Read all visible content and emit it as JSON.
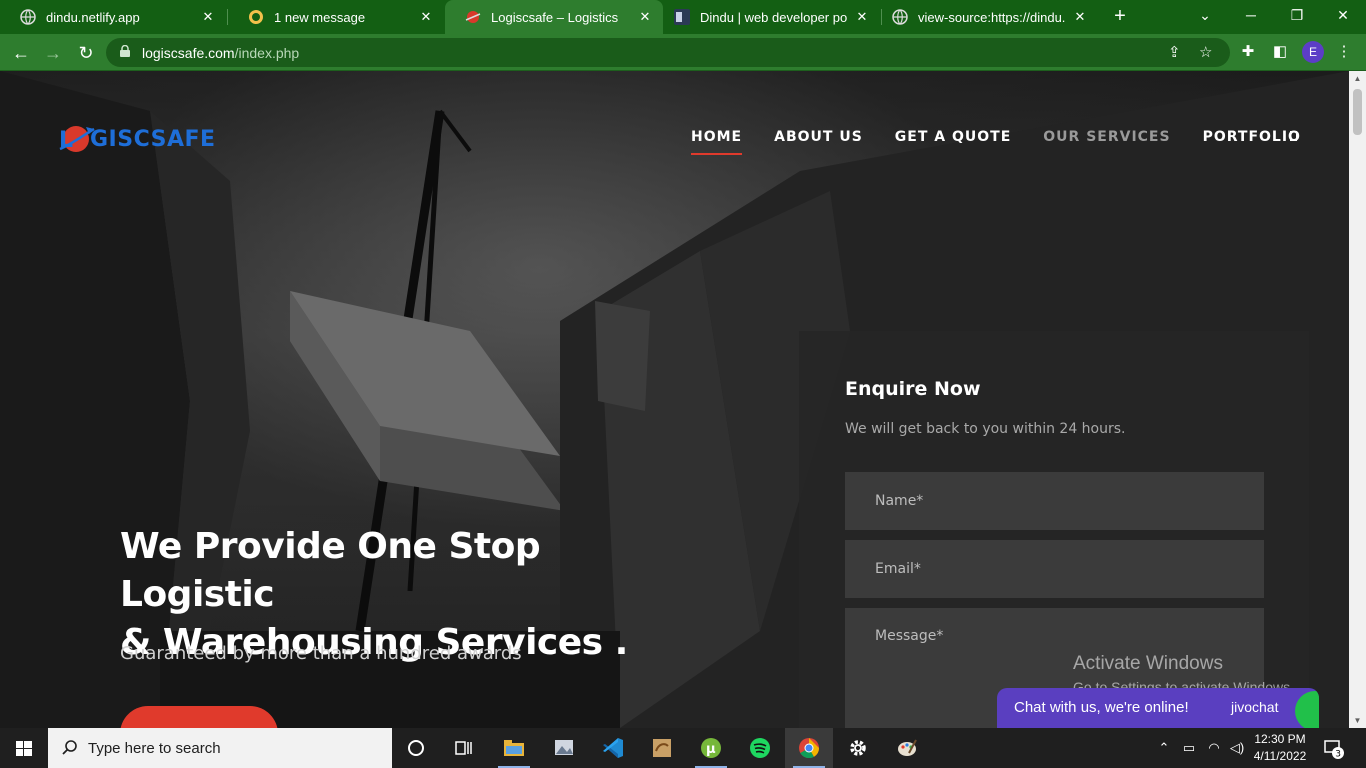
{
  "browser": {
    "tabs": [
      {
        "title": "dindu.netlify.app",
        "favicon": "globe-icon",
        "active": false
      },
      {
        "title": "1 new message",
        "favicon": "brand-icon",
        "active": false
      },
      {
        "title": "Logiscsafe – Logistics",
        "favicon": "planet-icon",
        "active": true
      },
      {
        "title": "Dindu | web developer portfo",
        "favicon": "thumbnail-icon",
        "active": false
      },
      {
        "title": "view-source:https://dindu.ne",
        "favicon": "globe-icon",
        "active": false
      }
    ],
    "new_tab_label": "+",
    "url_host": "logiscsafe.com",
    "url_path": "/index.php",
    "profile_initial": "E",
    "theme_color": "#2e7d2e"
  },
  "site": {
    "logo_text": "GISCSAFE",
    "logo_letter": "L",
    "nav": [
      {
        "label": "HOME",
        "current": true
      },
      {
        "label": "ABOUT US",
        "current": false
      },
      {
        "label": "GET A QUOTE",
        "current": false
      },
      {
        "label": "OUR SERVICES",
        "current": false,
        "dim": true
      },
      {
        "label": "PORTFOLIO",
        "current": false
      }
    ],
    "hero": {
      "headline_line1": "We Provide One Stop Logistic",
      "headline_line2": "& Warehousing Services .",
      "subhead": "Guaranteed by more than a hundred awards"
    },
    "enquire": {
      "title": "Enquire Now",
      "subtitle": "We will get back to you within 24 hours.",
      "name_placeholder": "Name*",
      "email_placeholder": "Email*",
      "message_placeholder": "Message*"
    },
    "accent_color": "#e03a2c",
    "logo_color": "#1e6ed8"
  },
  "overlay": {
    "activate_title": "Activate Windows",
    "activate_sub": "Go to Settings to activate Windows."
  },
  "chat_widget": {
    "message": "Chat with us, we're online!",
    "brand": "jivochat",
    "color": "#5a3fc0"
  },
  "taskbar": {
    "search_placeholder": "Type here to search",
    "time": "12:30 PM",
    "date": "4/11/2022",
    "notification_count": "3",
    "apps": [
      "cortana-icon",
      "task-view-icon",
      "file-explorer-icon",
      "image-viewer-icon",
      "vscode-icon",
      "sublime-icon",
      "utorrent-icon",
      "spotify-icon",
      "chrome-icon",
      "settings-icon",
      "paint-icon"
    ]
  }
}
